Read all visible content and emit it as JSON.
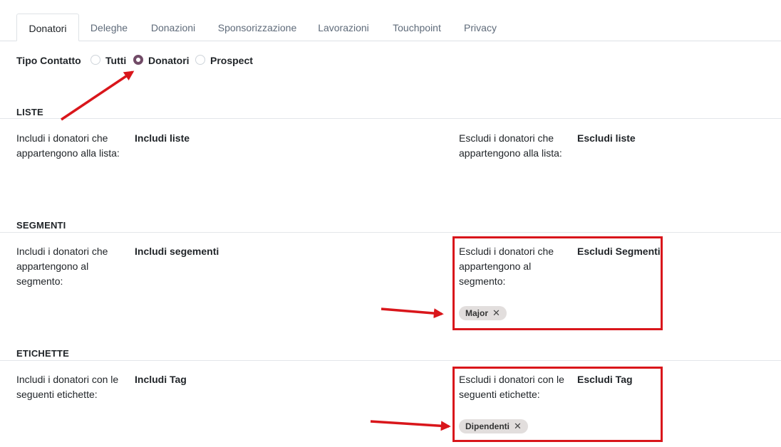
{
  "tabs": [
    {
      "label": "Donatori",
      "active": true
    },
    {
      "label": "Deleghe"
    },
    {
      "label": "Donazioni"
    },
    {
      "label": "Sponsorizzazione"
    },
    {
      "label": "Lavorazioni"
    },
    {
      "label": "Touchpoint"
    },
    {
      "label": "Privacy"
    }
  ],
  "tipo_contatto": {
    "label": "Tipo Contatto",
    "options": [
      "Tutti",
      "Donatori",
      "Prospect"
    ],
    "selected": "Donatori"
  },
  "liste": {
    "title": "LISTE",
    "include_label": "Includi i donatori che appartengono alla lista:",
    "include_value": "Includi liste",
    "exclude_label": "Escludi i donatori che appartengono alla lista:",
    "exclude_value": "Escludi liste"
  },
  "segmenti": {
    "title": "SEGMENTI",
    "include_label": "Includi i donatori che appartengono al segmento:",
    "include_value": "Includi segementi",
    "exclude_label": "Escludi i donatori che appartengono al segmento:",
    "exclude_value": "Escludi Segmenti",
    "exclude_tags": [
      "Major"
    ]
  },
  "etichette": {
    "title": "ETICHETTE",
    "include_label": "Includi i donatori con le seguenti etichette:",
    "include_value": "Includi Tag",
    "exclude_label": "Escludi i donatori con le seguenti etichette:",
    "exclude_value": "Escludi Tag",
    "exclude_tags": [
      "Dipendenti"
    ]
  },
  "icons": {
    "remove": "close-icon",
    "arrow": "arrow-annotation"
  },
  "colors": {
    "accent": "#714b67",
    "annotation": "#d9161b",
    "tag_bg": "#e2dedd"
  }
}
